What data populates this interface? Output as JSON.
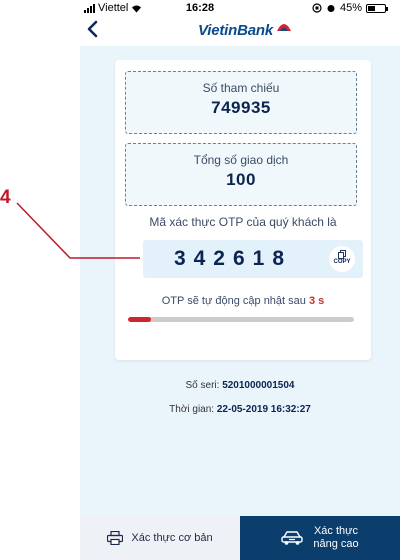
{
  "status_bar": {
    "carrier": "Viettel",
    "time": "16:28",
    "battery": "45%",
    "battery_level": 0.45
  },
  "header": {
    "logo_text": "VietinBank"
  },
  "card": {
    "ref_label": "Số tham chiếu",
    "ref_value": "749935",
    "total_label": "Tổng số giao dịch",
    "total_value": "100",
    "otp_caption": "Mã xác thực OTP của quý khách là",
    "otp_code": "342618",
    "copy_label": "COPY",
    "refresh_prefix": "OTP sẽ tự động cập nhật sau",
    "refresh_seconds": "3 s",
    "progress_fraction": 0.1
  },
  "meta": {
    "serial_label": "Số seri:",
    "serial_value": "5201000001504",
    "time_label": "Thời gian:",
    "time_value": "22-05-2019 16:32:27"
  },
  "annotation": {
    "number": "4"
  },
  "tabs": {
    "basic_label": "Xác thực cơ bản",
    "advanced_line1": "Xác thực",
    "advanced_line2": "nâng cao"
  },
  "colors": {
    "accent_red": "#d0262b",
    "brand_navy": "#0b3d6d"
  }
}
